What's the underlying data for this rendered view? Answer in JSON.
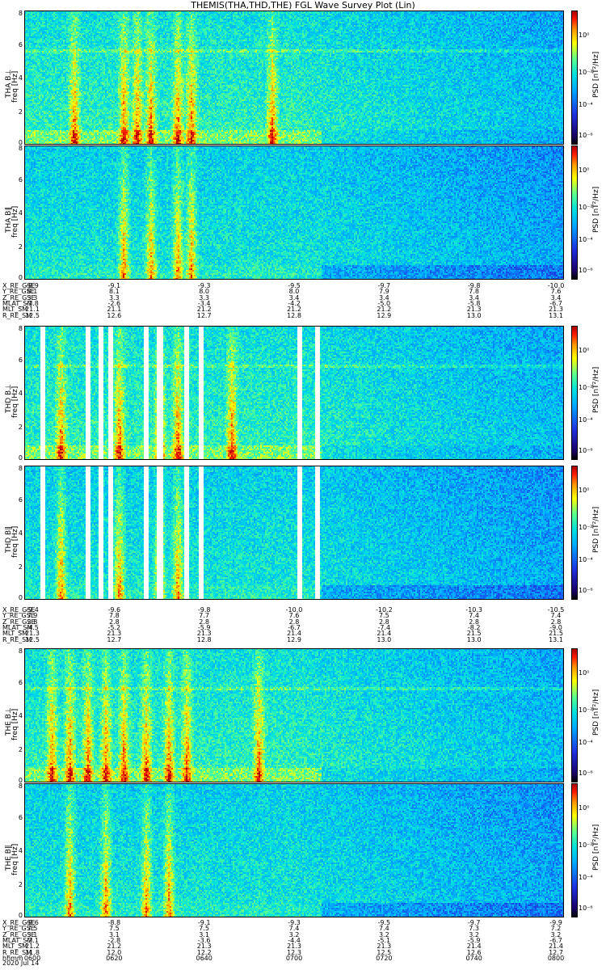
{
  "title": "THEMIS(THA,THD,THE) FGL Wave Survey Plot (Lin)",
  "colorbar": {
    "label": "PSD [nT²/Hz]",
    "ticks": [
      "10⁰",
      "10⁻²",
      "10⁻⁴",
      "10⁻⁶"
    ]
  },
  "panels": [
    {
      "label": "THA B⊥",
      "ylabel": "freq [Hz]",
      "yticks": [
        "8",
        "6",
        "4",
        "2",
        "0"
      ]
    },
    {
      "label": "THA B∥",
      "ylabel": "freq [Hz]",
      "yticks": [
        "8",
        "6",
        "4",
        "2",
        "0"
      ]
    },
    {
      "label": "THD B⊥",
      "ylabel": "freq [Hz]",
      "yticks": [
        "8",
        "6",
        "4",
        "2",
        "0"
      ]
    },
    {
      "label": "THD B∥",
      "ylabel": "freq [Hz]",
      "yticks": [
        "8",
        "6",
        "4",
        "2",
        "0"
      ]
    },
    {
      "label": "THE B⊥",
      "ylabel": "freq [Hz]",
      "yticks": [
        "8",
        "6",
        "4",
        "2",
        "0"
      ]
    },
    {
      "label": "THE B∥",
      "ylabel": "freq [Hz]",
      "yticks": [
        "8",
        "6",
        "4",
        "2",
        "0"
      ]
    }
  ],
  "ephemeris_blocks": [
    {
      "rows": [
        {
          "name": "X_RE_GSE",
          "values": [
            "-8.9",
            "-9.1",
            "-9.3",
            "-9.5",
            "-9.7",
            "-9.8",
            "-10.0"
          ]
        },
        {
          "name": "Y_RE_GSE",
          "values": [
            "8.1",
            "8.1",
            "8.0",
            "8.0",
            "7.9",
            "7.8",
            "7.6"
          ]
        },
        {
          "name": "Z_RE_GSE",
          "values": [
            "3.3",
            "3.3",
            "3.3",
            "3.4",
            "3.4",
            "3.4",
            "3.4"
          ]
        },
        {
          "name": "MLAT_SM",
          "values": [
            "-1.8",
            "-2.6",
            "-3.4",
            "-4.2",
            "-5.0",
            "-5.8",
            "-6.7"
          ]
        },
        {
          "name": "MLT_SM",
          "values": [
            "21.1",
            "21.1",
            "21.2",
            "21.2",
            "21.2",
            "21.3",
            "21.3"
          ]
        },
        {
          "name": "R_RE_SM",
          "values": [
            "12.5",
            "12.6",
            "12.7",
            "12.8",
            "12.9",
            "13.0",
            "13.1"
          ]
        }
      ]
    },
    {
      "rows": [
        {
          "name": "X_RE_GSE",
          "values": [
            "-9.4",
            "-9.6",
            "-9.8",
            "-10.0",
            "-10.2",
            "-10.3",
            "-10.5"
          ]
        },
        {
          "name": "Y_RE_GSE",
          "values": [
            "7.9",
            "7.8",
            "7.7",
            "7.6",
            "7.5",
            "7.4",
            "7.4"
          ]
        },
        {
          "name": "Z_RE_GSE",
          "values": [
            "2.8",
            "2.8",
            "2.8",
            "2.8",
            "2.8",
            "2.8",
            "2.8"
          ]
        },
        {
          "name": "MLAT_SM",
          "values": [
            "-4.5",
            "-5.2",
            "-5.9",
            "-6.7",
            "-7.4",
            "-8.2",
            "-9.0"
          ]
        },
        {
          "name": "MLT_SM",
          "values": [
            "21.3",
            "21.3",
            "21.3",
            "21.4",
            "21.4",
            "21.5",
            "21.5"
          ]
        },
        {
          "name": "R_RE_SM",
          "values": [
            "12.5",
            "12.7",
            "12.8",
            "12.9",
            "13.0",
            "13.0",
            "13.1"
          ]
        }
      ]
    },
    {
      "rows": [
        {
          "name": "X_RE_GSE",
          "values": [
            "-8.6",
            "-8.8",
            "-9.1",
            "-9.3",
            "-9.5",
            "-9.7",
            "-9.9"
          ]
        },
        {
          "name": "Y_RE_GSE",
          "values": [
            "7.5",
            "7.5",
            "7.5",
            "7.4",
            "7.4",
            "7.3",
            "7.2"
          ]
        },
        {
          "name": "Z_RE_GSE",
          "values": [
            "3.1",
            "3.1",
            "3.1",
            "3.2",
            "3.2",
            "3.2",
            "3.2"
          ]
        },
        {
          "name": "MLAT_SM",
          "values": [
            "-2.1",
            "-2.8",
            "-3.6",
            "-4.4",
            "-5.1",
            "-5.9",
            "-6.7"
          ]
        },
        {
          "name": "MLT_SM",
          "values": [
            "21.2",
            "21.2",
            "21.3",
            "21.3",
            "21.3",
            "21.4",
            "21.4"
          ]
        },
        {
          "name": "R_RE_SM",
          "values": [
            "11.8",
            "12.0",
            "12.2",
            "12.3",
            "12.5",
            "12.6",
            "12.7"
          ]
        },
        {
          "name": "hhmm",
          "values": [
            "0600",
            "0620",
            "0640",
            "0700",
            "0720",
            "0740",
            "0800"
          ]
        }
      ]
    }
  ],
  "date_label": "2020 Jul 14",
  "chart_data": {
    "type": "heatmap",
    "title": "THEMIS(THA,THD,THE) FGL Wave Survey Plot (Lin)",
    "xlabel": "hhmm",
    "x_ticks": [
      "0600",
      "0620",
      "0640",
      "0700",
      "0720",
      "0740",
      "0800"
    ],
    "ylabel": "freq [Hz]",
    "ylim": [
      0,
      8
    ],
    "colorbar_label": "PSD [nT²/Hz]",
    "colorbar_scale": "log",
    "panels": [
      {
        "name": "THA B⊥",
        "bursts_hhmm": [
          "0611",
          "0622",
          "0625",
          "0628",
          "0634",
          "0637",
          "0655"
        ],
        "gaps_hhmm": []
      },
      {
        "name": "THA B∥",
        "bursts_hhmm": [
          "0622",
          "0628",
          "0634",
          "0637"
        ],
        "gaps_hhmm": []
      },
      {
        "name": "THD B⊥",
        "bursts_hhmm": [
          "0608",
          "0621",
          "0630",
          "0634",
          "0646"
        ],
        "gaps_hhmm": [
          "0604",
          "0614",
          "0617",
          "0619",
          "0627",
          "0630",
          "0636",
          "0639",
          "0701",
          "0705"
        ]
      },
      {
        "name": "THD B∥",
        "bursts_hhmm": [
          "0608",
          "0621",
          "0630",
          "0634"
        ],
        "gaps_hhmm": [
          "0604",
          "0614",
          "0617",
          "0619",
          "0627",
          "0630",
          "0636",
          "0639",
          "0701",
          "0705"
        ]
      },
      {
        "name": "THE B⊥",
        "bursts_hhmm": [
          "0606",
          "0610",
          "0614",
          "0618",
          "0622",
          "0627",
          "0632",
          "0636",
          "0652"
        ],
        "gaps_hhmm": []
      },
      {
        "name": "THE B∥",
        "bursts_hhmm": [
          "0610",
          "0618",
          "0627",
          "0632"
        ],
        "gaps_hhmm": []
      }
    ]
  }
}
